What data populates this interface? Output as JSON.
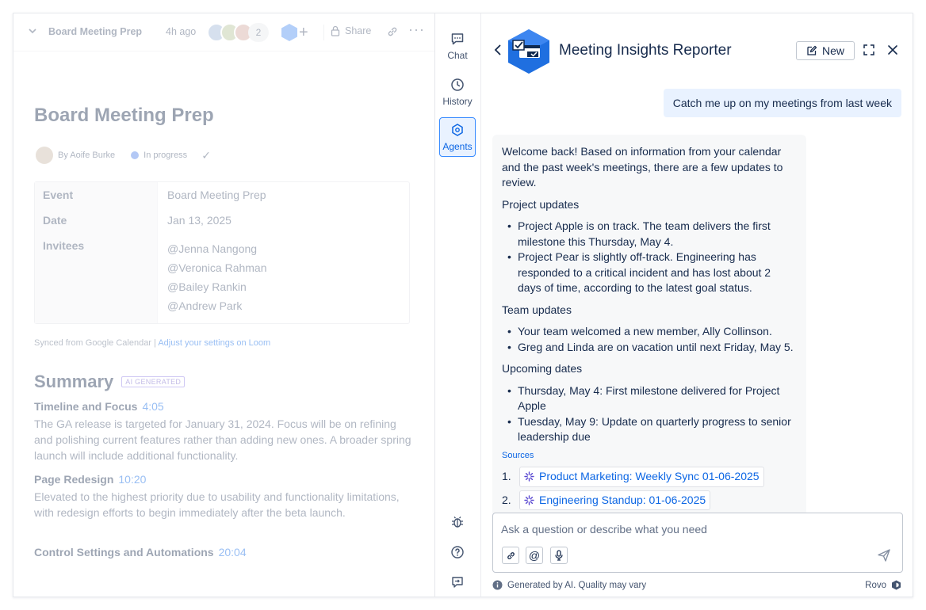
{
  "doc": {
    "toolbar": {
      "title": "Board Meeting Prep",
      "time": "4h ago",
      "avatar_count": "2",
      "share_label": "Share"
    },
    "title": "Board Meeting Prep",
    "meta": {
      "author": "By Aoife Burke",
      "status": "In progress"
    },
    "table": {
      "event_label": "Event",
      "event_value": "Board Meeting Prep",
      "date_label": "Date",
      "date_value": "Jan 13, 2025",
      "invitees_label": "Invitees",
      "invitees": [
        "@Jenna Nangong",
        "@Veronica Rahman",
        "@Bailey Rankin",
        "@Andrew Park"
      ]
    },
    "synced_text": "Synced from Google Calendar | ",
    "synced_link": "Adjust your settings on Loom",
    "summary": {
      "title": "Summary",
      "badge": "AI GENERATED",
      "sections": [
        {
          "heading": "Timeline and Focus",
          "time": "4:05",
          "body": "The GA release is targeted for January 31, 2024. Focus will be on refining and polishing current features rather than adding new ones. A broader spring launch will include additional functionality."
        },
        {
          "heading": "Page Redesign",
          "time": "10:20",
          "body": "Elevated to the highest priority due to usability and functionality limitations, with redesign efforts to begin immediately after the beta launch."
        },
        {
          "heading": "Control Settings and Automations",
          "time": "20:04",
          "body": ""
        }
      ]
    }
  },
  "rail": {
    "items": [
      {
        "label": "Chat"
      },
      {
        "label": "History"
      },
      {
        "label": "Agents"
      }
    ]
  },
  "chat": {
    "title": "Meeting Insights Reporter",
    "new_label": "New",
    "user_message": "Catch me up on my meetings from last week",
    "bot": {
      "intro": "Welcome back! Based on information from your calendar and the past week's meetings, there are a few updates to review.",
      "project_heading": "Project updates",
      "project_items": [
        "Project Apple is on track. The team delivers the first milestone this Thursday, May 4.",
        "Project Pear is slightly off-track. Engineering has responded to a critical incident and has lost about 2 days of time, according to the latest goal status."
      ],
      "team_heading": "Team updates",
      "team_items": [
        "Your team welcomed a new member, Ally Collinson.",
        "Greg and Linda are on vacation until next Friday, May 5."
      ],
      "upcoming_heading": "Upcoming dates",
      "upcoming_items": [
        "Thursday, May 4: First milestone delivered for Project Apple",
        "Tuesday, May 9: Update on quarterly progress to senior leadership due"
      ],
      "sources_label": "Sources",
      "sources": [
        {
          "num": "1.",
          "label": "Product Marketing: Weekly Sync 01-06-2025"
        },
        {
          "num": "2.",
          "label": "Engineering Standup: 01-06-2025"
        }
      ]
    },
    "input_placeholder": "Ask a question or describe what you need",
    "footer_left": "Generated by AI. Quality may vary",
    "footer_right": "Rovo"
  }
}
